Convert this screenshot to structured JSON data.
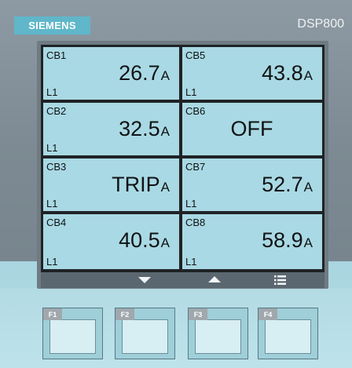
{
  "header": {
    "brand": "SIEMENS",
    "model": "DSP800"
  },
  "breakers": [
    {
      "name": "CB1",
      "phase": "L1",
      "value": "26.7",
      "unit": "A"
    },
    {
      "name": "CB5",
      "phase": "L1",
      "value": "43.8",
      "unit": "A"
    },
    {
      "name": "CB2",
      "phase": "L1",
      "value": "32.5",
      "unit": "A"
    },
    {
      "name": "CB6",
      "phase": "",
      "value": "OFF",
      "unit": ""
    },
    {
      "name": "CB3",
      "phase": "L1",
      "value": "TRIP",
      "unit": "A"
    },
    {
      "name": "CB7",
      "phase": "L1",
      "value": "52.7",
      "unit": "A"
    },
    {
      "name": "CB4",
      "phase": "L1",
      "value": "40.5",
      "unit": "A"
    },
    {
      "name": "CB8",
      "phase": "L1",
      "value": "58.9",
      "unit": "A"
    }
  ],
  "softkeys": {
    "left_icon": "arrow-down-icon",
    "middle_icon": "arrow-up-icon",
    "right_icon": "menu-list-icon"
  },
  "function_keys": [
    {
      "label": "F1"
    },
    {
      "label": "F2"
    },
    {
      "label": "F3"
    },
    {
      "label": "F4"
    }
  ],
  "colors": {
    "brand": "#5fb7c9",
    "lcd_background": "#a9d9e4",
    "panel": "#7e8b93",
    "keypad": "#b7dfe7"
  }
}
